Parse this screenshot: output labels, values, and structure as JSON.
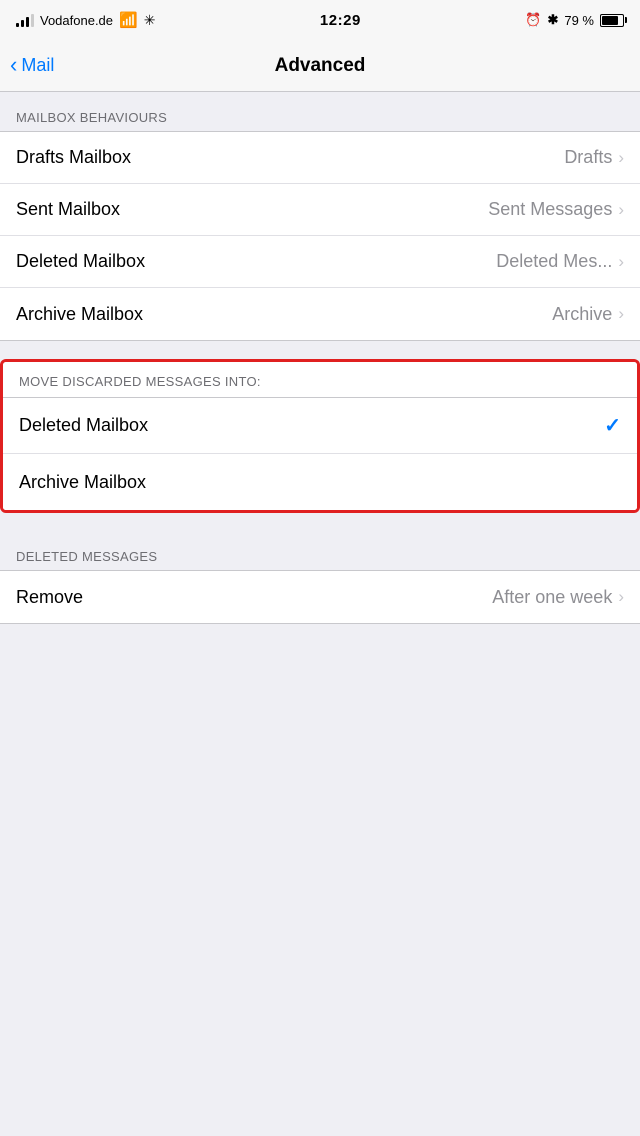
{
  "statusBar": {
    "carrier": "Vodafone.de",
    "time": "12:29",
    "battery_percent": "79 %"
  },
  "navBar": {
    "back_label": "Mail",
    "title": "Advanced"
  },
  "mailboxBehaviours": {
    "section_header": "MAILBOX BEHAVIOURS",
    "rows": [
      {
        "label": "Drafts Mailbox",
        "value": "Drafts"
      },
      {
        "label": "Sent Mailbox",
        "value": "Sent Messages"
      },
      {
        "label": "Deleted Mailbox",
        "value": "Deleted Mes..."
      },
      {
        "label": "Archive Mailbox",
        "value": "Archive"
      }
    ]
  },
  "moveDiscarded": {
    "section_header": "MOVE DISCARDED MESSAGES INTO:",
    "rows": [
      {
        "label": "Deleted Mailbox",
        "checked": true
      },
      {
        "label": "Archive Mailbox",
        "checked": false
      }
    ]
  },
  "deletedMessages": {
    "section_header": "DELETED MESSAGES",
    "rows": [
      {
        "label": "Remove",
        "value": "After one week"
      }
    ]
  }
}
